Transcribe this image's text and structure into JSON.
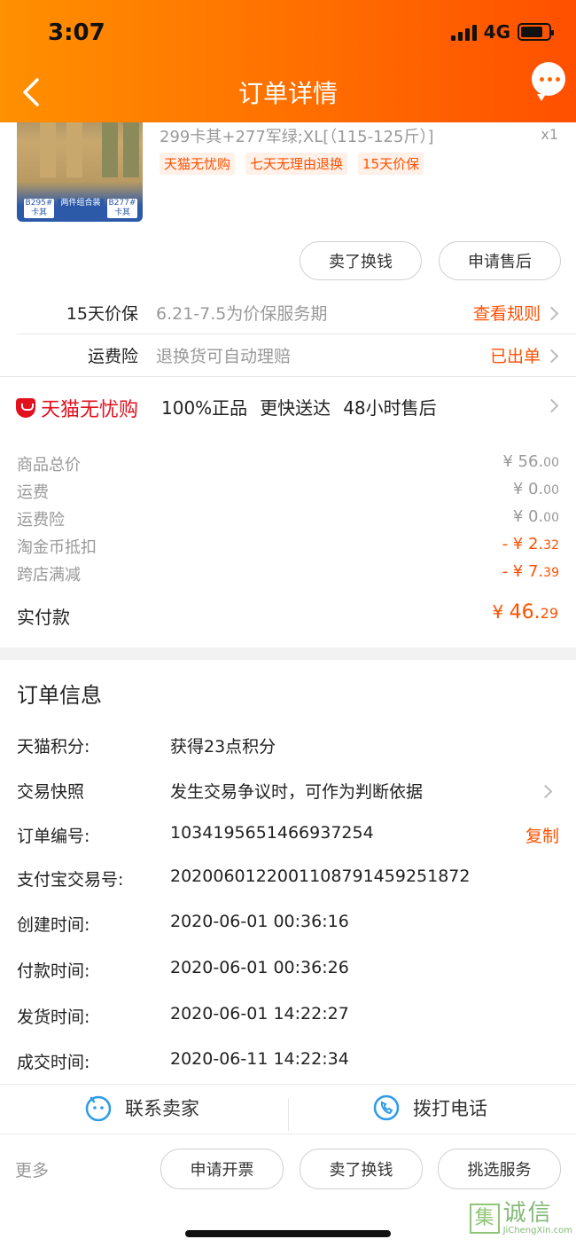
{
  "status_bar": {
    "time": "3:07",
    "network": "4G"
  },
  "nav": {
    "title": "订单详情"
  },
  "product": {
    "spec": "299卡其+277军绿;XL[（115-125斤）]",
    "qty": "x1",
    "tags": [
      "天猫无忧购",
      "七天无理由退换",
      "15天价保"
    ],
    "img_badges": [
      "B295# 卡其",
      "两件组合装",
      "B277# 卡其"
    ]
  },
  "actions": {
    "sell": "卖了换钱",
    "after_sale": "申请售后"
  },
  "services": [
    {
      "label": "15天价保",
      "desc": "6.21-7.5为价保服务期",
      "link": "查看规则"
    },
    {
      "label": "运费险",
      "desc": "退换货可自动理赔",
      "link": "已出单"
    }
  ],
  "tmall": {
    "brand": "天猫无忧购",
    "features": [
      "100%正品",
      "更快送达",
      "48小时售后"
    ]
  },
  "prices": [
    {
      "label": "商品总价",
      "int": "¥ 56.",
      "dec": "00",
      "highlight": false
    },
    {
      "label": "运费",
      "int": "¥ 0.",
      "dec": "00",
      "highlight": false
    },
    {
      "label": "运费险",
      "int": "¥ 0.",
      "dec": "00",
      "highlight": false
    },
    {
      "label": "淘金币抵扣",
      "int": "- ¥ 2.",
      "dec": "32",
      "highlight": true
    },
    {
      "label": "跨店满减",
      "int": "- ¥ 7.",
      "dec": "39",
      "highlight": true
    }
  ],
  "total": {
    "label": "实付款",
    "currency": "¥",
    "int": "46.",
    "dec": "29"
  },
  "order_info": {
    "title": "订单信息",
    "rows": [
      {
        "label": "天猫积分:",
        "value": "获得23点积分"
      },
      {
        "label": "交易快照",
        "value": "发生交易争议时，可作为判断依据"
      },
      {
        "label": "订单编号:",
        "value": "1034195651466937254",
        "action": "复制"
      },
      {
        "label": "支付宝交易号:",
        "value": "2020060122001108791459251872"
      },
      {
        "label": "创建时间:",
        "value": "2020-06-01 00:36:16"
      },
      {
        "label": "付款时间:",
        "value": "2020-06-01 00:36:26"
      },
      {
        "label": "发货时间:",
        "value": "2020-06-01 14:22:27"
      },
      {
        "label": "成交时间:",
        "value": "2020-06-11 14:22:34"
      }
    ]
  },
  "contact": {
    "seller": "联系卖家",
    "call": "拨打电话"
  },
  "bottom": {
    "more": "更多",
    "invoice": "申请开票",
    "sell": "卖了换钱",
    "service": "挑选服务"
  },
  "watermark": {
    "icon": "集",
    "cn": "诚信",
    "en": "JiChengXin.com"
  }
}
